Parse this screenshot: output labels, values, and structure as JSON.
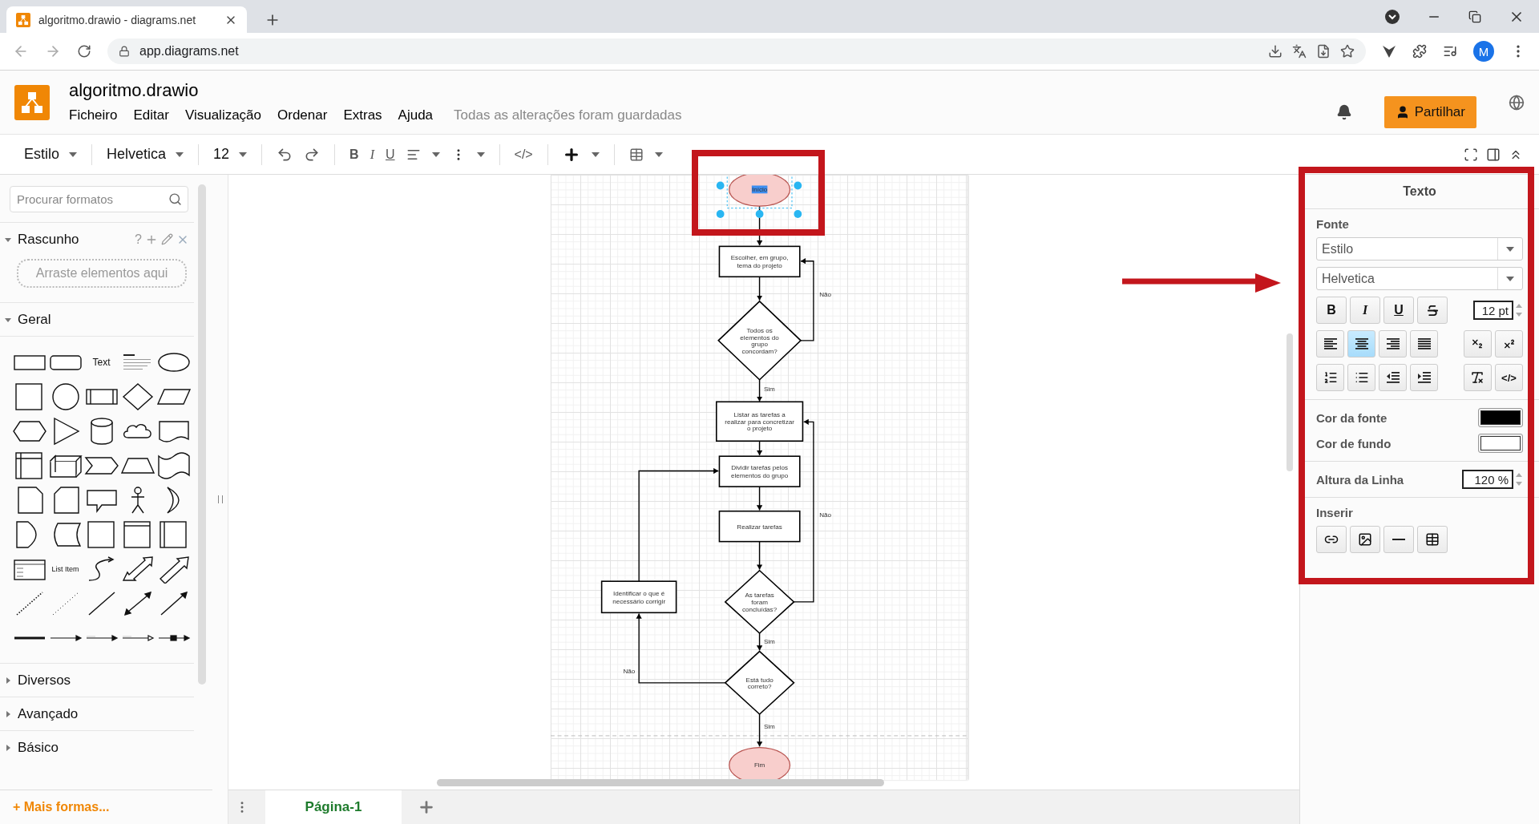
{
  "browser": {
    "tab_title": "algoritmo.drawio - diagrams.net",
    "address": "app.diagrams.net",
    "profile_initial": "M"
  },
  "app": {
    "file_name": "algoritmo.drawio",
    "menus": [
      "Ficheiro",
      "Editar",
      "Visualização",
      "Ordenar",
      "Extras",
      "Ajuda"
    ],
    "save_status": "Todas as alterações foram guardadas",
    "share_button": "Partilhar"
  },
  "toolbar": {
    "style": "Estilo",
    "font": "Helvetica",
    "size": "12",
    "bold": "B",
    "italic": "I",
    "underline": "U",
    "html": "</>"
  },
  "sidebar": {
    "search_placeholder": "Procurar formatos",
    "scratchpad": {
      "title": "Rascunho",
      "expanded": true,
      "help": "?",
      "drop_hint": "Arraste elementos aqui"
    },
    "sections": [
      {
        "title": "Geral",
        "expanded": true
      },
      {
        "title": "Diversos",
        "expanded": false
      },
      {
        "title": "Avançado",
        "expanded": false
      },
      {
        "title": "Básico",
        "expanded": false
      }
    ],
    "shapes": [
      {
        "kind": "rect"
      },
      {
        "kind": "rounded"
      },
      {
        "kind": "text",
        "label": "Text"
      },
      {
        "kind": "textblock"
      },
      {
        "kind": "ellipse"
      },
      {
        "kind": "square"
      },
      {
        "kind": "circle"
      },
      {
        "kind": "process"
      },
      {
        "kind": "diamond"
      },
      {
        "kind": "parallelogram"
      },
      {
        "kind": "hexagon"
      },
      {
        "kind": "triangle"
      },
      {
        "kind": "cylinder"
      },
      {
        "kind": "cloud"
      },
      {
        "kind": "document"
      },
      {
        "kind": "storage"
      },
      {
        "kind": "cube"
      },
      {
        "kind": "step"
      },
      {
        "kind": "trapezoid"
      },
      {
        "kind": "tape"
      },
      {
        "kind": "note"
      },
      {
        "kind": "card"
      },
      {
        "kind": "callout"
      },
      {
        "kind": "actor"
      },
      {
        "kind": "crescent"
      },
      {
        "kind": "delay"
      },
      {
        "kind": "datastore"
      },
      {
        "kind": "square"
      },
      {
        "kind": "header"
      },
      {
        "kind": "side"
      },
      {
        "kind": "list"
      },
      {
        "kind": "text",
        "label": "List Item"
      },
      {
        "kind": "curve"
      },
      {
        "kind": "doublearrow"
      },
      {
        "kind": "blockarrow"
      },
      {
        "kind": "dotted"
      },
      {
        "kind": "dotted2"
      },
      {
        "kind": "line"
      },
      {
        "kind": "bidir"
      },
      {
        "kind": "linearrow"
      },
      {
        "kind": "thick"
      },
      {
        "kind": "conn1"
      },
      {
        "kind": "conn2"
      },
      {
        "kind": "conn3"
      },
      {
        "kind": "conn4"
      }
    ],
    "more_shapes": "+ Mais formas..."
  },
  "diagram": {
    "nodes": [
      {
        "kind": "terminal",
        "label": "Início",
        "selected": true
      },
      {
        "kind": "process",
        "label": "Escolher, em grupo, tema do projeto",
        "selected": false
      },
      {
        "kind": "decision",
        "label": "Todos os elementos do grupo concordam?",
        "selected": false
      },
      {
        "kind": "process",
        "label": "Listar as tarefas a realizar para concretizar o projeto",
        "selected": false
      },
      {
        "kind": "process",
        "label": "Dividir tarefas pelos elementos do grupo",
        "selected": false
      },
      {
        "kind": "process",
        "label": "Realizar tarefas",
        "selected": false
      },
      {
        "kind": "process",
        "label": "Identificar o que é necessário corrigir",
        "selected": false
      },
      {
        "kind": "decision",
        "label": "As tarefas foram concluídas?",
        "selected": false
      },
      {
        "kind": "decision",
        "label": "Está tudo correto?",
        "selected": false
      },
      {
        "kind": "terminal",
        "label": "Fim",
        "selected": false
      }
    ],
    "edge_labels": [
      "Não",
      "Sim",
      "Não",
      "Sim",
      "Não",
      "Sim"
    ]
  },
  "pages": [
    {
      "label": "Página-1",
      "selected": true
    }
  ],
  "format_panel": {
    "title": "Texto",
    "font_section": "Fonte",
    "style_select": "Estilo",
    "font_select": "Helvetica",
    "style_buttons": [
      {
        "kind": "bold",
        "label": "B"
      },
      {
        "kind": "italic",
        "label": "I"
      },
      {
        "kind": "underline",
        "label": "U"
      },
      {
        "kind": "strike"
      }
    ],
    "font_size": "12 pt",
    "align": [
      {
        "kind": "left",
        "selected": false
      },
      {
        "kind": "center",
        "selected": true
      },
      {
        "kind": "right",
        "selected": false
      },
      {
        "kind": "justify",
        "selected": false
      }
    ],
    "html_button": "</>",
    "colors": [
      {
        "label": "Cor da fonte",
        "color": "#000000"
      },
      {
        "label": "Cor de fundo",
        "color": "#ffffff"
      }
    ],
    "line_height": {
      "label": "Altura da Linha",
      "value": "120 %"
    },
    "insert_title": "Inserir"
  }
}
